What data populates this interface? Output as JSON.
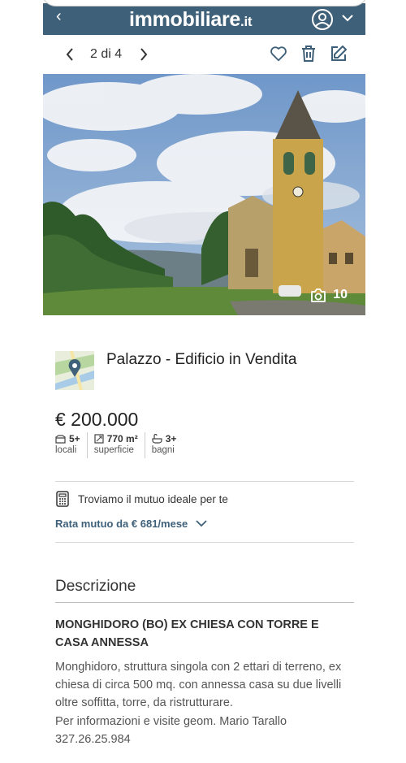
{
  "header": {
    "logo_text": "immobiliare",
    "logo_tld": ".it",
    "back_icon": "chevron-left-icon",
    "user_icon": "user-icon",
    "menu_icon": "chevron-down-icon",
    "background": "#3f6079"
  },
  "pager": {
    "counter": "2 di 4",
    "prev_icon": "chevron-left-icon",
    "next_icon": "chevron-right-icon",
    "favorite_icon": "heart-icon",
    "delete_icon": "trash-icon",
    "edit_icon": "edit-icon"
  },
  "photo": {
    "count": "10",
    "icon": "camera-icon"
  },
  "listing": {
    "title": "Palazzo - Edificio in Vendita",
    "price": "€ 200.000",
    "features": [
      {
        "icon": "rooms-icon",
        "value": "5+",
        "label": "locali"
      },
      {
        "icon": "area-icon",
        "value": "770 m²",
        "label": "superficie"
      },
      {
        "icon": "bath-icon",
        "value": "3+",
        "label": "bagni"
      }
    ]
  },
  "mutuo": {
    "icon": "calculator-icon",
    "text": "Troviamo il mutuo ideale per te",
    "rate": "Rata mutuo da € 681/mese"
  },
  "description": {
    "section_title": "Descrizione",
    "heading": "MONGHIDORO (BO) EX CHIESA CON TORRE E CASA ANNESSA",
    "body_line1": "Monghidoro, struttura singola con 2 ettari di terreno, ex chiesa di circa 500 mq. con annessa casa su due livelli oltre soffitta, torre, da ristrutturare.",
    "body_line2": "Per informazioni e visite geom. Mario Tarallo 327.26.25.984"
  },
  "colors": {
    "accent": "#3f6079",
    "text": "#222222",
    "muted": "#555555"
  }
}
